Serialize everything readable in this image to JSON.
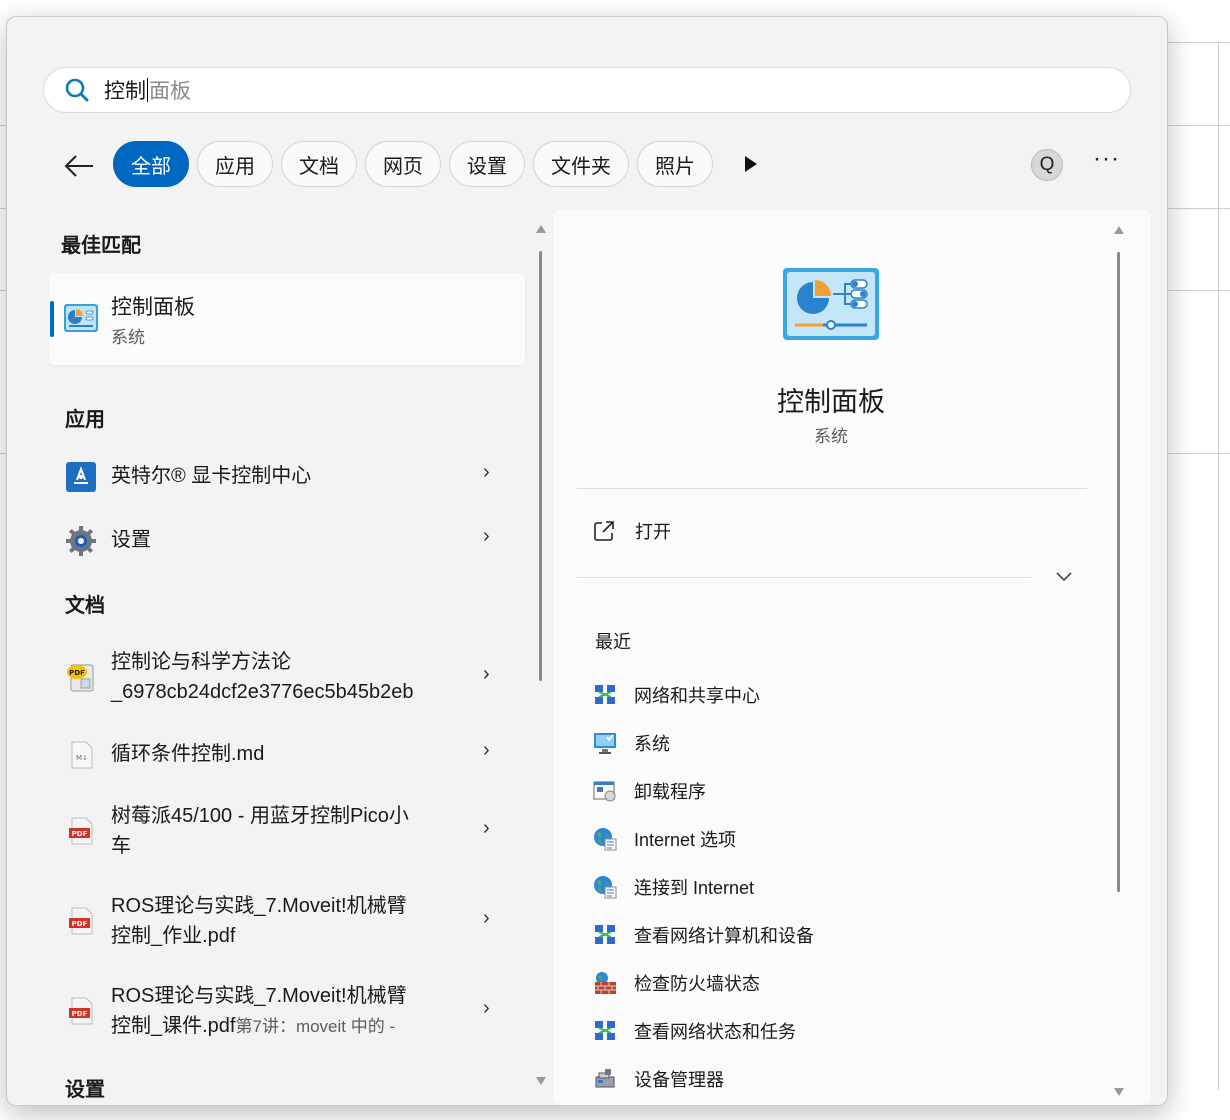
{
  "search": {
    "typed": "控制",
    "suggestion": "面板"
  },
  "filters": {
    "back_icon": "arrow-left-icon",
    "chips": [
      "全部",
      "应用",
      "文档",
      "网页",
      "设置",
      "文件夹",
      "照片"
    ],
    "active": "全部",
    "avatar_letter": "Q",
    "more_label": "···"
  },
  "left": {
    "best_match": {
      "heading": "最佳匹配",
      "title": "控制面板",
      "subtitle": "系统",
      "icon": "control-panel-icon"
    },
    "apps_heading": "应用",
    "apps": [
      {
        "label": "英特尔® 显卡控制中心",
        "icon": "intel-graphics-icon"
      },
      {
        "label": "设置",
        "icon": "gear-icon"
      }
    ],
    "docs_heading": "文档",
    "docs": [
      {
        "line1": "控制论与科学方法论",
        "line2": "_6978cb24dcf2e3776ec5b45b2eb",
        "icon": "pdf-reader-icon"
      },
      {
        "line1": "循环条件控制.md",
        "line2": "",
        "icon": "markdown-file-icon"
      },
      {
        "line1": "树莓派45/100 - 用蓝牙控制Pico小",
        "line2": "车",
        "icon": "pdf-icon"
      },
      {
        "line1": "ROS理论与实践_7.Moveit!机械臂",
        "line2": "控制_作业.pdf",
        "icon": "pdf-icon"
      },
      {
        "line1": "ROS理论与实践_7.Moveit!机械臂",
        "line2": "控制_课件.pdf",
        "line2_extra": "第7讲：moveit 中的 -",
        "icon": "pdf-icon"
      }
    ],
    "settings_heading": "设置"
  },
  "right": {
    "title": "控制面板",
    "subtitle": "系统",
    "open_label": "打开",
    "recent_heading": "最近",
    "recent": [
      {
        "label": "网络和共享中心",
        "icon": "network-icon"
      },
      {
        "label": "系统",
        "icon": "monitor-icon"
      },
      {
        "label": "卸载程序",
        "icon": "uninstall-icon"
      },
      {
        "label": "Internet 选项",
        "icon": "globe-icon"
      },
      {
        "label": "连接到 Internet",
        "icon": "globe-icon"
      },
      {
        "label": "查看网络计算机和设备",
        "icon": "network-icon"
      },
      {
        "label": "检查防火墙状态",
        "icon": "firewall-icon"
      },
      {
        "label": "查看网络状态和任务",
        "icon": "network-icon"
      },
      {
        "label": "设备管理器",
        "icon": "device-manager-icon"
      }
    ]
  },
  "colors": {
    "accent": "#0067c0",
    "panel_bg": "#f3f3f3",
    "card_bg": "#fbfbfb"
  }
}
